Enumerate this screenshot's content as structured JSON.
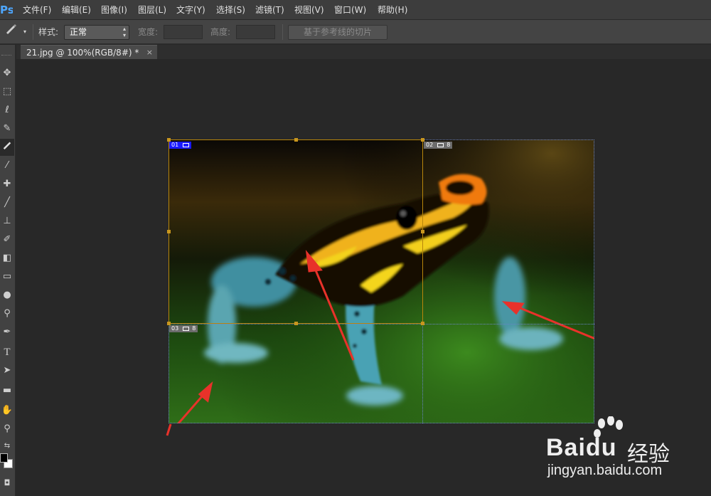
{
  "app": {
    "logo": "Ps"
  },
  "menubar": {
    "items": [
      "文件(F)",
      "编辑(E)",
      "图像(I)",
      "图层(L)",
      "文字(Y)",
      "选择(S)",
      "滤镜(T)",
      "视图(V)",
      "窗口(W)",
      "帮助(H)"
    ]
  },
  "options": {
    "style_label": "样式:",
    "style_value": "正常",
    "width_label": "宽度:",
    "width_value": "",
    "height_label": "高度:",
    "height_value": "",
    "slice_from_guides_button": "基于参考线的切片"
  },
  "tools": [
    "move-tool",
    "marquee-tool",
    "lasso-tool",
    "quick-select-tool",
    "slice-tool",
    "eyedropper-tool",
    "healing-brush-tool",
    "brush-tool",
    "clone-stamp-tool",
    "history-brush-tool",
    "eraser-tool",
    "gradient-tool",
    "blur-tool",
    "dodge-tool",
    "pen-tool",
    "type-tool",
    "path-select-tool",
    "rectangle-tool",
    "hand-tool",
    "zoom-tool"
  ],
  "document": {
    "tab_title": "21.jpg @ 100%(RGB/8#) *",
    "close_glyph": "×"
  },
  "slices": [
    {
      "id": "01",
      "icon": "image-icon",
      "state": "selected"
    },
    {
      "id": "02",
      "icon": "image-icon",
      "extra": "8"
    },
    {
      "id": "03",
      "icon": "image-icon",
      "extra": "8"
    }
  ],
  "colors": {
    "selection_border": "#b8860b",
    "selected_tag_bg": "#1a1aff",
    "annotation_arrow": "#e8322a"
  },
  "watermark": {
    "brand": "Bai",
    "brand_suffix": "du",
    "cn": "经验",
    "url": "jingyan.baidu.com"
  }
}
